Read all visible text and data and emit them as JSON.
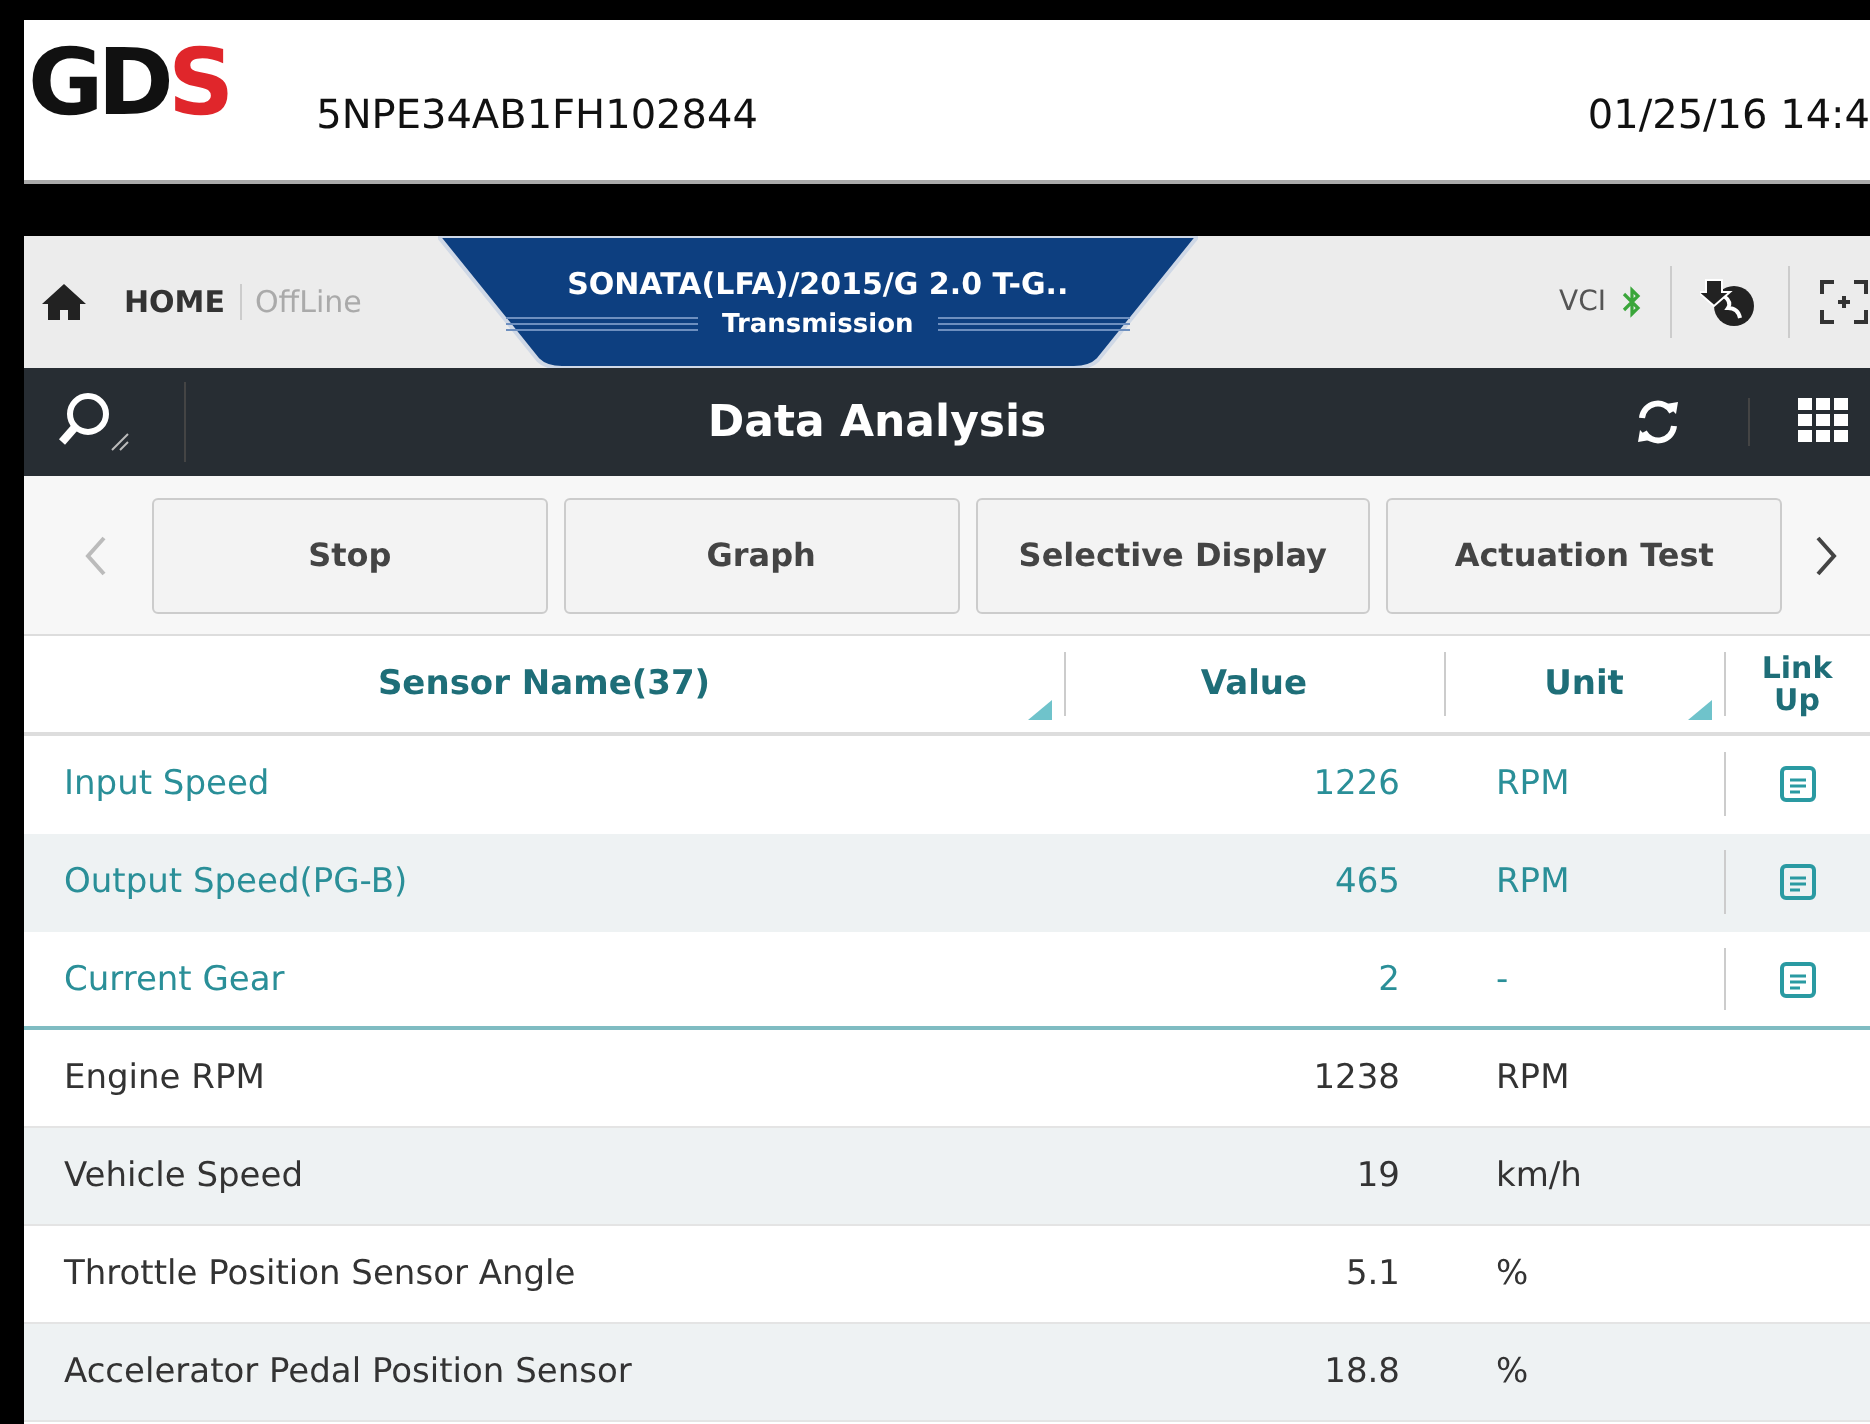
{
  "logo": {
    "text": "GD",
    "accent": "S"
  },
  "vin": "5NPE34AB1FH102844",
  "datetime": "01/25/16 14:4",
  "nav": {
    "home": "HOME",
    "mode": "OffLine",
    "vehicle": "SONATA(LFA)/2015/G 2.0 T-G..",
    "system": "Transmission",
    "vci": "VCI",
    "bluetooth": true
  },
  "title": "Data Analysis",
  "buttons": [
    "Stop",
    "Graph",
    "Selective Display",
    "Actuation Test"
  ],
  "columns": [
    "Sensor Name(37)",
    "Value",
    "Unit",
    "Link Up"
  ],
  "rows": [
    {
      "name": "Input Speed",
      "value": "1226",
      "unit": "RPM",
      "linked": true
    },
    {
      "name": "Output Speed(PG-B)",
      "value": "465",
      "unit": "RPM",
      "linked": true
    },
    {
      "name": "Current Gear",
      "value": "2",
      "unit": "-",
      "linked": true
    },
    {
      "name": "Engine RPM",
      "value": "1238",
      "unit": "RPM",
      "linked": false
    },
    {
      "name": "Vehicle Speed",
      "value": "19",
      "unit": "km/h",
      "linked": false
    },
    {
      "name": "Throttle Position Sensor Angle",
      "value": "5.1",
      "unit": "%",
      "linked": false
    },
    {
      "name": "Accelerator Pedal Position Sensor",
      "value": "18.8",
      "unit": "%",
      "linked": false
    }
  ]
}
